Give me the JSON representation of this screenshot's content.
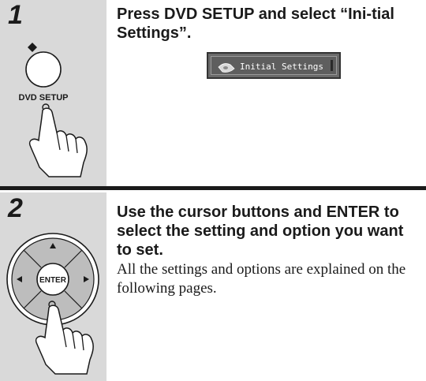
{
  "steps": [
    {
      "number": "1",
      "heading": "Press DVD SETUP and select “Ini-tial Settings”.",
      "button_label": "DVD SETUP",
      "osd_label": "Initial Settings"
    },
    {
      "number": "2",
      "heading": "Use the cursor buttons and ENTER to select the setting and option you want to set.",
      "body": "All the settings and options are explained on the following pages.",
      "center_label": "ENTER"
    }
  ],
  "icons": [
    "dvd-setup-button-icon",
    "pointing-hand-icon",
    "disc-icon",
    "cursor-pad-icon",
    "arrow-up-icon",
    "arrow-down-icon",
    "arrow-left-icon",
    "arrow-right-icon"
  ]
}
